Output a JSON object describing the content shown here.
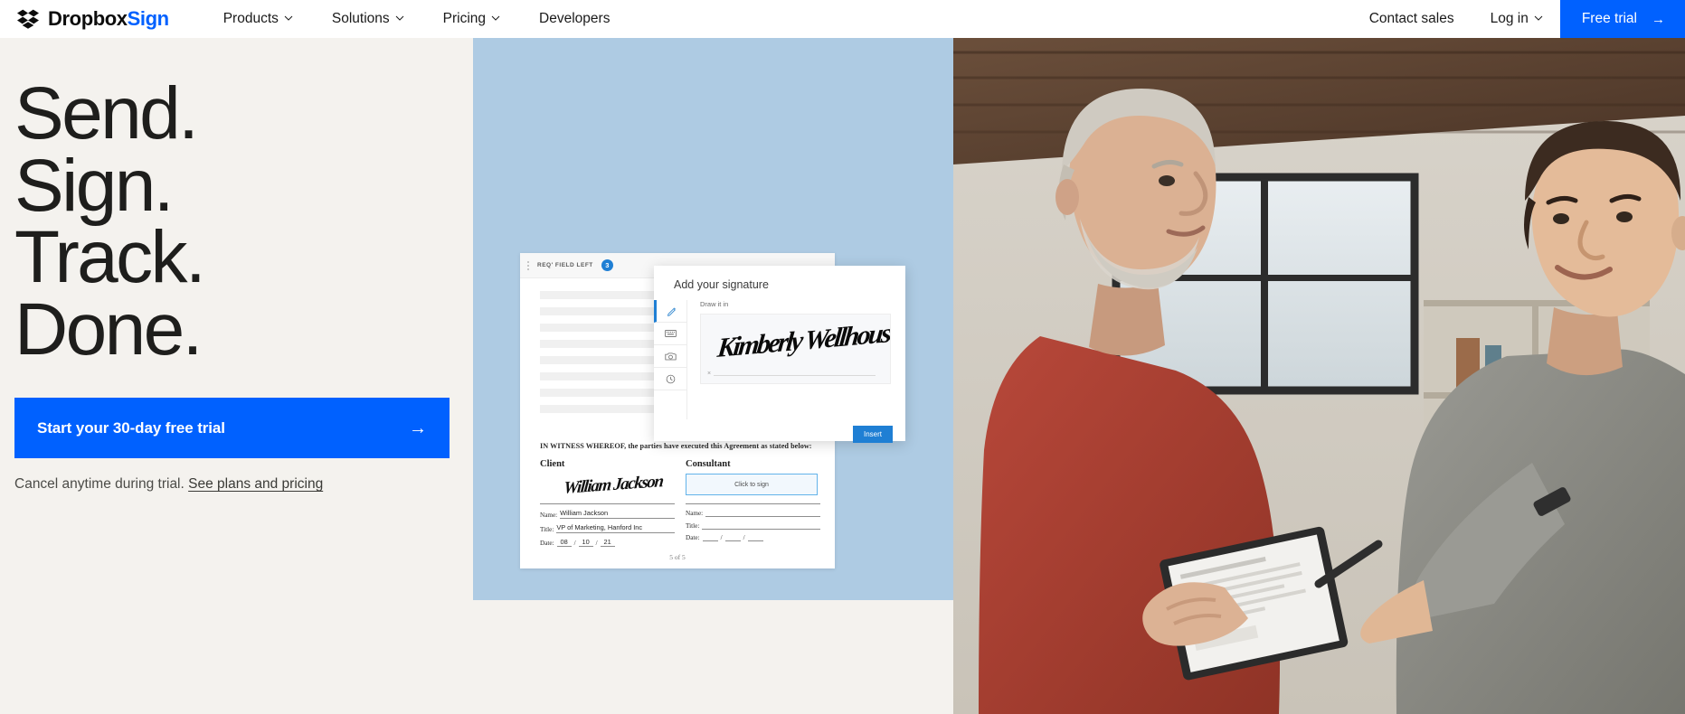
{
  "brand": {
    "name_primary": "Dropbox",
    "name_secondary": "Sign",
    "logo_icon": "dropbox-sign-logo-icon",
    "accent_blue": "#0061ff",
    "text_dark": "#1e1e1c",
    "hero_bg": "#f4f2ee",
    "mid_panel_bg": "#aecbe3"
  },
  "nav": {
    "links": [
      {
        "label": "Products",
        "has_dropdown": true,
        "icon": "chevron-down-icon"
      },
      {
        "label": "Solutions",
        "has_dropdown": true,
        "icon": "chevron-down-icon"
      },
      {
        "label": "Pricing",
        "has_dropdown": true,
        "icon": "chevron-down-icon"
      },
      {
        "label": "Developers",
        "has_dropdown": false,
        "icon": ""
      }
    ],
    "contact_sales": "Contact sales",
    "log_in": "Log in",
    "log_in_icon": "chevron-down-icon",
    "free_trial": "Free trial",
    "free_trial_arrow": "→"
  },
  "hero": {
    "headline_lines": [
      "Send.",
      "Sign.",
      "Track.",
      "Done."
    ],
    "cta_label": "Start your 30-day free trial",
    "cta_arrow": "→",
    "sub_text": "Cancel anytime during trial.",
    "sub_link": "See plans and pricing"
  },
  "document": {
    "toolbar": {
      "menu_icon": "kebab-menu-icon",
      "required_label": "REQ' FIELD LEFT",
      "required_count": "3"
    },
    "witness_text": "IN WITNESS WHEREOF, the parties have executed this Agreement as stated below:",
    "page_indicator": "5 of 5",
    "client": {
      "title": "Client",
      "signature_script": "William Jackson",
      "name_label": "Name:",
      "name_value": "William Jackson",
      "title_label": "Title:",
      "title_value": "VP of Marketing, Hanford Inc",
      "date_label": "Date:",
      "date_day": "08",
      "date_month": "10",
      "date_year": "21"
    },
    "consultant": {
      "title": "Consultant",
      "click_to_sign": "Click to sign",
      "name_label": "Name:",
      "name_value": "",
      "title_label": "Title:",
      "title_value": "",
      "date_label": "Date:",
      "date_day": "",
      "date_month": "",
      "date_year": ""
    }
  },
  "signature_modal": {
    "title": "Add your signature",
    "draw_label": "Draw it in",
    "tabs": [
      {
        "icon": "pen-draw-icon",
        "active": true
      },
      {
        "icon": "keyboard-type-icon",
        "active": false
      },
      {
        "icon": "camera-upload-icon",
        "active": false
      },
      {
        "icon": "clock-history-icon",
        "active": false
      }
    ],
    "drawn_signature": "Kimberly Wellhouse",
    "x_marker": "×",
    "insert_label": "Insert"
  },
  "photo": {
    "alt": "Two people reviewing a document on a tablet in a modern office"
  }
}
